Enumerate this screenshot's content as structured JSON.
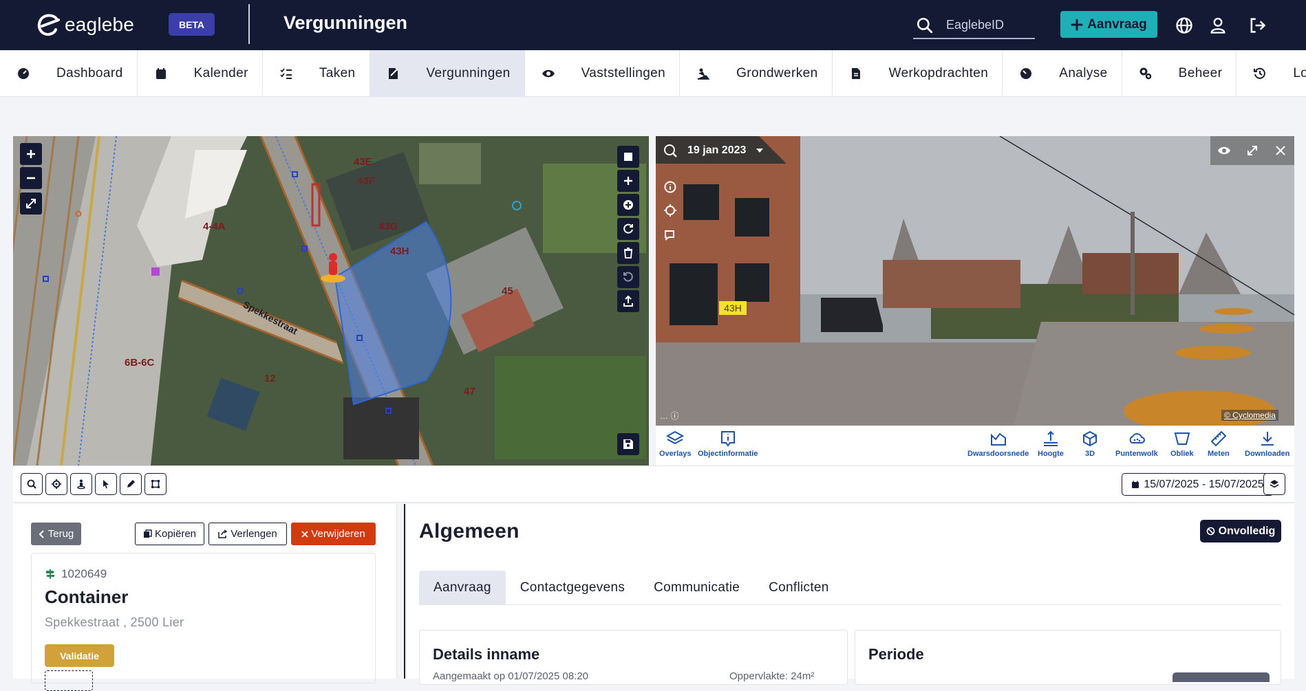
{
  "header": {
    "logo_text": "eaglebe",
    "beta_label": "BETA",
    "app_title": "Vergunningen",
    "search_placeholder": "EaglebeID",
    "new_request_label": "Aanvraag"
  },
  "nav": {
    "items": [
      {
        "label": "Dashboard",
        "icon": "dashboard-icon"
      },
      {
        "label": "Kalender",
        "icon": "calendar-icon"
      },
      {
        "label": "Taken",
        "icon": "tasks-icon"
      },
      {
        "label": "Vergunningen",
        "icon": "permit-icon",
        "active": true
      },
      {
        "label": "Vaststellingen",
        "icon": "eye-icon"
      },
      {
        "label": "Grondwerken",
        "icon": "excavation-icon"
      },
      {
        "label": "Werkopdrachten",
        "icon": "document-icon"
      },
      {
        "label": "Analyse",
        "icon": "analysis-icon"
      },
      {
        "label": "Beheer",
        "icon": "cogs-icon"
      },
      {
        "label": "Logs",
        "icon": "history-icon"
      }
    ]
  },
  "map": {
    "street_label": "Spekkestraat",
    "parcel_labels": [
      "43E",
      "43F",
      "43G",
      "43H",
      "4-4A",
      "6B-6C",
      "12",
      "45",
      "47"
    ]
  },
  "streetview": {
    "date_label": "19 jan 2023",
    "house_number": "43H",
    "copyright": "© Cyclomedia",
    "toolbar": [
      {
        "label": "Overlays",
        "icon": "layers-icon"
      },
      {
        "label": "Objectinformatie",
        "icon": "info-icon"
      },
      {
        "label": "Dwarsdoorsnede",
        "icon": "cross-section-icon"
      },
      {
        "label": "Hoogte",
        "icon": "height-icon"
      },
      {
        "label": "3D",
        "icon": "cube-icon"
      },
      {
        "label": "Puntenwolk",
        "icon": "point-cloud-icon"
      },
      {
        "label": "Obliek",
        "icon": "oblique-icon"
      },
      {
        "label": "Meten",
        "icon": "ruler-icon"
      },
      {
        "label": "Downloaden",
        "icon": "download-icon"
      }
    ]
  },
  "tools": {
    "date_range": "15/07/2025 - 15/07/2025"
  },
  "dossier": {
    "back_label": "Terug",
    "copy_label": "Kopiëren",
    "extend_label": "Verlengen",
    "delete_label": "Verwijderen",
    "number": "1020649",
    "type": "Container",
    "address": "Spekkestraat , 2500 Lier",
    "status": "Validatie"
  },
  "detail": {
    "title": "Algemeen",
    "status_label": "Onvolledig",
    "tabs": [
      "Aanvraag",
      "Contactgegevens",
      "Communicatie",
      "Conflicten"
    ],
    "details_title": "Details inname",
    "created_label": "Aangemaakt op 01/07/2025 08:20",
    "area_label": "Oppervlakte: 24m²",
    "period_title": "Periode"
  }
}
